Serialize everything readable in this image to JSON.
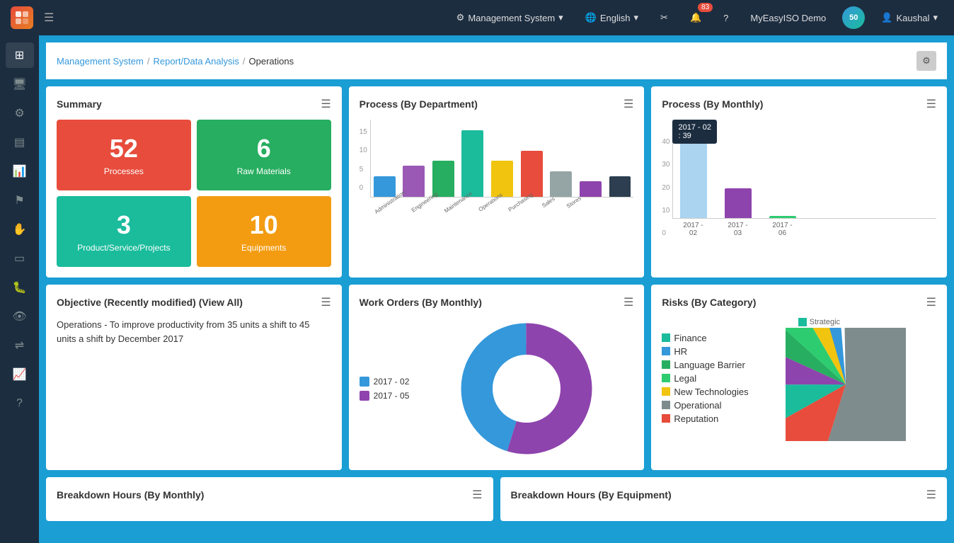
{
  "topnav": {
    "logo_text": "M",
    "management_system_label": "Management System",
    "english_label": "English",
    "notification_count": "83",
    "user_label": "MyEasyISO Demo",
    "user_name": "Kaushal"
  },
  "breadcrumb": {
    "management_system": "Management System",
    "report_data_analysis": "Report/Data Analysis",
    "current": "Operations"
  },
  "summary": {
    "title": "Summary",
    "tiles": [
      {
        "number": "52",
        "label": "Processes",
        "color": "tile-red"
      },
      {
        "number": "6",
        "label": "Raw Materials",
        "color": "tile-green"
      },
      {
        "number": "3",
        "label": "Product/Service/Projects",
        "color": "tile-teal"
      },
      {
        "number": "10",
        "label": "Equipments",
        "color": "tile-orange"
      }
    ]
  },
  "process_by_department": {
    "title": "Process (By Department)",
    "y_labels": [
      "0",
      "5",
      "10",
      "15"
    ],
    "bars": [
      {
        "label": "Administration",
        "value": 4,
        "color": "#3498db"
      },
      {
        "label": "Engineering",
        "value": 6,
        "color": "#9b59b6"
      },
      {
        "label": "Maintenance",
        "value": 7,
        "color": "#27ae60"
      },
      {
        "label": "Operations",
        "value": 13,
        "color": "#1abc9c"
      },
      {
        "label": "Purchasing",
        "value": 7,
        "color": "#f1c40f"
      },
      {
        "label": "Sales",
        "value": 9,
        "color": "#e74c3c"
      },
      {
        "label": "Stores",
        "value": 5,
        "color": "#95a5a6"
      },
      {
        "label": "",
        "value": 3,
        "color": "#8e44ad"
      },
      {
        "label": "",
        "value": 4,
        "color": "#2c3e50"
      }
    ]
  },
  "process_by_monthly": {
    "title": "Process (By Monthly)",
    "tooltip": "2017 - 02\n: 39",
    "y_labels": [
      "0",
      "10",
      "20",
      "30",
      "40"
    ],
    "bars": [
      {
        "label": "2017 - 02",
        "value": 39,
        "color": "#aad4f0",
        "height": 140
      },
      {
        "label": "2017 - 03",
        "value": 12,
        "color": "#8e44ad",
        "height": 43
      },
      {
        "label": "2017 - 06",
        "value": 1,
        "color": "#2ecc71",
        "height": 4
      }
    ]
  },
  "objective": {
    "title": "Objective (Recently modified) (View All)",
    "text": "Operations - To improve productivity from 35 units a shift to 45 units a shift by December 2017"
  },
  "work_orders": {
    "title": "Work Orders (By Monthly)",
    "legend": [
      {
        "label": "2017 - 02",
        "color": "#3498db"
      },
      {
        "label": "2017 - 05",
        "color": "#8e44ad"
      }
    ]
  },
  "risks_by_category": {
    "title": "Risks (By Category)",
    "legend": [
      {
        "label": "Finance",
        "color": "#1abc9c"
      },
      {
        "label": "HR",
        "color": "#3498db"
      },
      {
        "label": "Language Barrier",
        "color": "#27ae60"
      },
      {
        "label": "Legal",
        "color": "#2ecc71"
      },
      {
        "label": "New Technologies",
        "color": "#f1c40f"
      },
      {
        "label": "Operational",
        "color": "#7f8c8d"
      },
      {
        "label": "Reputation",
        "color": "#e74c3c"
      }
    ],
    "strategic_label": "Strategic",
    "strategic_color": "#1abc9c"
  },
  "breakdown_hours_monthly": {
    "title": "Breakdown Hours (By Monthly)"
  },
  "breakdown_hours_equipment": {
    "title": "Breakdown Hours (By Equipment)"
  },
  "sidebar_icons": [
    "☰",
    "🖥",
    "⚙",
    "💳",
    "📊",
    "🚩",
    "✋",
    "🗄",
    "🐛",
    "👁",
    "⇌",
    "📈",
    "❓"
  ]
}
